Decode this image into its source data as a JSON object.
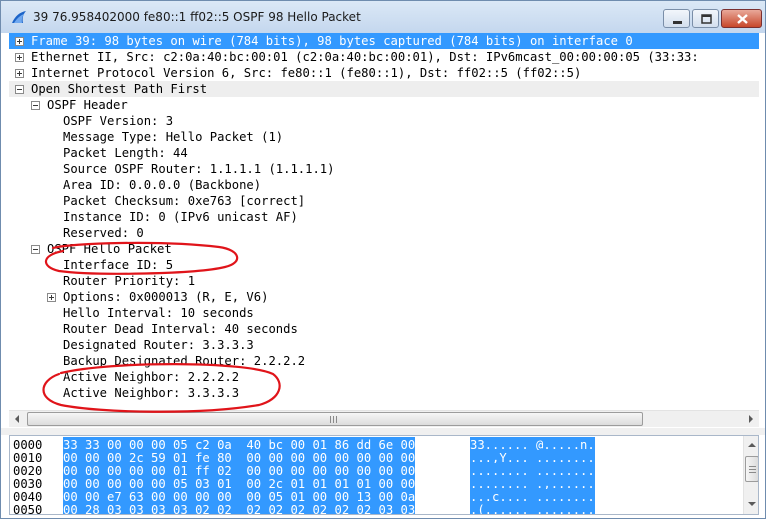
{
  "window": {
    "title": "39 76.958402000 fe80::1 ff02::5 OSPF 98 Hello Packet"
  },
  "tree": {
    "frame": "Frame 39: 98 bytes on wire (784 bits), 98 bytes captured (784 bits) on interface 0",
    "ethernet": "Ethernet II, Src: c2:0a:40:bc:00:01 (c2:0a:40:bc:00:01), Dst: IPv6mcast_00:00:00:05 (33:33:",
    "ipv6": "Internet Protocol Version 6, Src: fe80::1 (fe80::1), Dst: ff02::5 (ff02::5)",
    "ospf": "Open Shortest Path First",
    "header": {
      "label": "OSPF Header",
      "version": "OSPF Version: 3",
      "msg_type": "Message Type: Hello Packet (1)",
      "length": "Packet Length: 44",
      "router": "Source OSPF Router: 1.1.1.1 (1.1.1.1)",
      "area": "Area ID: 0.0.0.0 (Backbone)",
      "checksum": "Packet Checksum: 0xe763 [correct]",
      "instance": "Instance ID: 0 (IPv6 unicast AF)",
      "reserved": "Reserved: 0"
    },
    "hello": {
      "label": "OSPF Hello Packet",
      "interface_id": "Interface ID: 5",
      "priority": "Router Priority: 1",
      "options": "Options: 0x000013 (R, E, V6)",
      "hello_interval": "Hello Interval: 10 seconds",
      "dead_interval": "Router Dead Interval: 40 seconds",
      "dr": "Designated Router: 3.3.3.3",
      "bdr": "Backup Designated Router: 2.2.2.2",
      "neighbor1": "Active Neighbor: 2.2.2.2",
      "neighbor2": "Active Neighbor: 3.3.3.3"
    }
  },
  "hex": {
    "rows": [
      {
        "offset": "0000",
        "bytes": "33 33 00 00 00 05 c2 0a  40 bc 00 01 86 dd 6e 00",
        "ascii": "33...... @.....n."
      },
      {
        "offset": "0010",
        "bytes": "00 00 00 2c 59 01 fe 80  00 00 00 00 00 00 00 00",
        "ascii": "...,Y... ........"
      },
      {
        "offset": "0020",
        "bytes": "00 00 00 00 00 01 ff 02  00 00 00 00 00 00 00 00",
        "ascii": "........ ........"
      },
      {
        "offset": "0030",
        "bytes": "00 00 00 00 00 05 03 01  00 2c 01 01 01 01 00 00",
        "ascii": "........ .,......"
      },
      {
        "offset": "0040",
        "bytes": "00 00 e7 63 00 00 00 00  00 05 01 00 00 13 00 0a",
        "ascii": "...c.... ........"
      },
      {
        "offset": "0050",
        "bytes": "00 28 03 03 03 03 02 02  02 02 02 02 02 02 03 03",
        "ascii": ".(...... ........"
      }
    ]
  },
  "colors": {
    "selection": "#3399ff",
    "annotation": "#e0141a"
  }
}
